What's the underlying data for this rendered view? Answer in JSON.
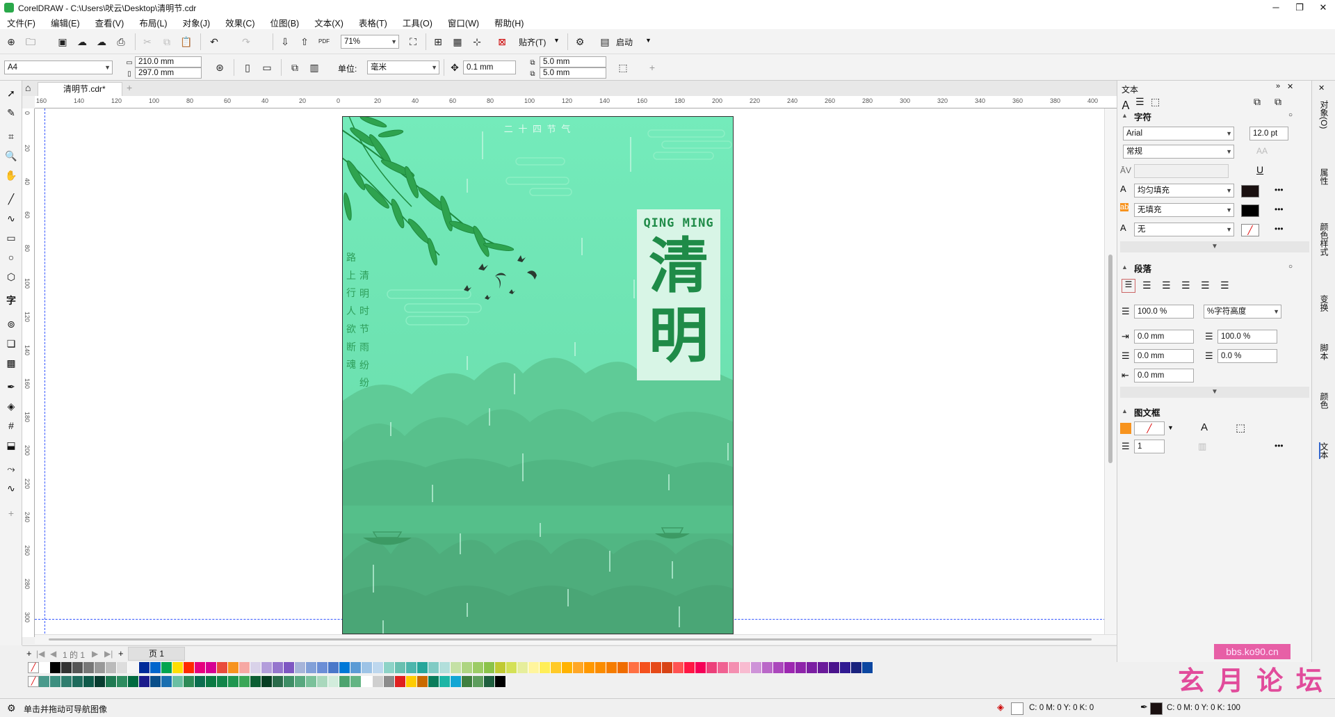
{
  "window": {
    "title": "CorelDRAW - C:\\Users\\吠云\\Desktop\\清明节.cdr",
    "controls": [
      "─",
      "❐",
      "✕"
    ]
  },
  "menu": [
    "文件(F)",
    "编辑(E)",
    "查看(V)",
    "布局(L)",
    "对象(J)",
    "效果(C)",
    "位图(B)",
    "文本(X)",
    "表格(T)",
    "工具(O)",
    "窗口(W)",
    "帮助(H)"
  ],
  "toolbar": {
    "zoom": "71%",
    "paste_label": "贴齐(T)",
    "launch_label": "启动",
    "pdf_label": "PDF"
  },
  "propbar": {
    "page_size": "A4",
    "width": "210.0 mm",
    "height": "297.0 mm",
    "units_label": "单位:",
    "units_value": "毫米",
    "nudge": "0.1 mm",
    "dup_x": "5.0 mm",
    "dup_y": "5.0 mm"
  },
  "doc_tab": "清明节.cdr*",
  "ruler_h": [
    "160",
    "140",
    "120",
    "100",
    "80",
    "60",
    "40",
    "20",
    "0",
    "20",
    "40",
    "60",
    "80",
    "100",
    "120",
    "140",
    "160",
    "180",
    "200",
    "220",
    "240",
    "260",
    "280",
    "300",
    "320",
    "340",
    "360",
    "380",
    "400"
  ],
  "ruler_v": [
    "0",
    "20",
    "40",
    "60",
    "80",
    "100",
    "120",
    "140",
    "160",
    "180",
    "200",
    "220",
    "240",
    "260",
    "280",
    "300"
  ],
  "poster": {
    "top_label": "二 十 四 节 气",
    "brand_en": "QING MING",
    "brand_cn_1": "清",
    "brand_cn_2": "明",
    "poem_col_left": [
      "路",
      "上",
      "行",
      "人",
      "欲",
      "断",
      "魂"
    ],
    "poem_col_right": [
      "清",
      "明",
      "时",
      "节",
      "雨",
      "纷",
      "纷"
    ],
    "colors": {
      "sky_top": "#72e8b8",
      "sky_bottom": "#65d9a5",
      "mountain_far": "#5ec997",
      "mountain_mid": "#56bd8a",
      "mountain_near": "#4fb07e",
      "leaf": "#2ea34f",
      "brand_bg": "#d8f5e6",
      "brand_fg": "#1f8b48"
    }
  },
  "pagenav": {
    "page_count": "1 的 1",
    "page_tab": "页 1"
  },
  "palette_row1": [
    "#ffffff",
    "#000000",
    "#333333",
    "#555555",
    "#777777",
    "#999999",
    "#bbbbbb",
    "#dddddd",
    "#f5f5f5",
    "#002b9a",
    "#0066cc",
    "#00a550",
    "#ffde00",
    "#ff2a00",
    "#e6007e",
    "#d60093",
    "#e94b3c",
    "#f7931e",
    "#f6a8a3",
    "#d9d2e9",
    "#b39ddb",
    "#9575cd",
    "#7e57c2",
    "#a6b4d9",
    "#82a0d8",
    "#6b8ed6",
    "#4a78c9",
    "#0078d7",
    "#5b9bd5",
    "#9dc3e6",
    "#bdd7ee",
    "#8dd3c7",
    "#69c0b0",
    "#4db6ac",
    "#26a69a",
    "#80cbc4",
    "#b2dfdb",
    "#c5e1a5",
    "#aed581",
    "#9ccc65",
    "#8bc34a",
    "#c0ca33",
    "#d4e157",
    "#e6ee9c",
    "#fff59d",
    "#ffee58",
    "#ffca28",
    "#ffb300",
    "#ffa726",
    "#ff9800",
    "#fb8c00",
    "#f57c00",
    "#ef6c00",
    "#ff7043",
    "#f4511e",
    "#e64a19",
    "#d84315",
    "#ff5252",
    "#ff1744",
    "#f50057",
    "#ec407a",
    "#f06292",
    "#f48fb1",
    "#f8bbd0",
    "#ce93d8",
    "#ba68c8",
    "#ab47bc",
    "#9c27b0",
    "#8e24aa",
    "#7b1fa2",
    "#6a1b9a",
    "#4a148c",
    "#311b92",
    "#1a237e",
    "#0d47a1"
  ],
  "palette_row2": [
    "#4a9a8c",
    "#3d8f80",
    "#2f7d6e",
    "#1e6b5c",
    "#0f5a4a",
    "#083c30",
    "#1f7a52",
    "#2d8c5f",
    "#006a3f",
    "#1c1c8c",
    "#0a4f8a",
    "#1a6fb0",
    "#6bbfa3",
    "#2e8b57",
    "#0b6e4f",
    "#0a7a43",
    "#12854a",
    "#1f9650",
    "#3aa657",
    "#0c5e33",
    "#073d22",
    "#2a6b4a",
    "#3e8e66",
    "#58a87f",
    "#7ac19a",
    "#a9d8bd",
    "#d2ecdc",
    "#4da36f",
    "#63b483",
    "#ffffff",
    "#cfcfcf",
    "#8c8c8c",
    "#e02020",
    "#ffcc00",
    "#c96a00",
    "#0b7d5b",
    "#1cb5a5",
    "#12a6d4",
    "#3f7f3f",
    "#5e9e5e",
    "#1f5f3f",
    "#000000"
  ],
  "status": {
    "hint": "单击并拖动可导航图像",
    "fill_cmyk": "C: 0 M: 0 Y: 0 K: 0",
    "outline_cmyk": "C: 0 M: 0 Y: 0 K: 100"
  },
  "docker": {
    "header": "文本",
    "char_section": "字符",
    "font": "Arial",
    "font_size": "12.0 pt",
    "font_style": "常规",
    "fill_type": "均匀填充",
    "bg_fill": "无填充",
    "outline": "无",
    "para_section": "段落",
    "line_spacing": "100.0 %",
    "line_spacing_unit": "%字符高度",
    "indent_left": "0.0 mm",
    "indent_first": "0.0 mm",
    "indent_right": "0.0 mm",
    "char_spacing": "100.0 %",
    "word_spacing": "0.0 %",
    "frame_section": "图文框",
    "columns": "1"
  },
  "right_tabs": [
    "对象(O)",
    "属性",
    "颜色样式",
    "变换",
    "脚本",
    "颜色",
    "文本"
  ],
  "watermark": {
    "url": "bbs.ko90.cn",
    "cn": "玄 月 论 坛"
  }
}
